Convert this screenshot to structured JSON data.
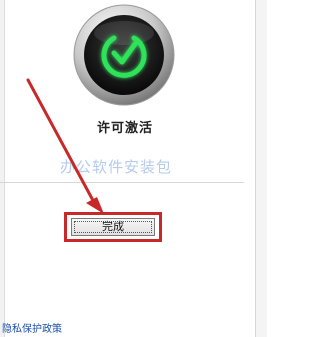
{
  "status": {
    "label": "许可激活",
    "icon": "green-check-circle-icon",
    "colors": {
      "ring": "#2ee25a",
      "disc": "#111111",
      "bezel": "#8a8a8a"
    }
  },
  "watermark": {
    "text": "办公软件安装包"
  },
  "done_button": {
    "label": "完成",
    "highlight_color": "#c8282a"
  },
  "annotation_arrow": {
    "color": "#c8282a"
  },
  "footer": {
    "privacy_link": "隐私保护政策"
  }
}
